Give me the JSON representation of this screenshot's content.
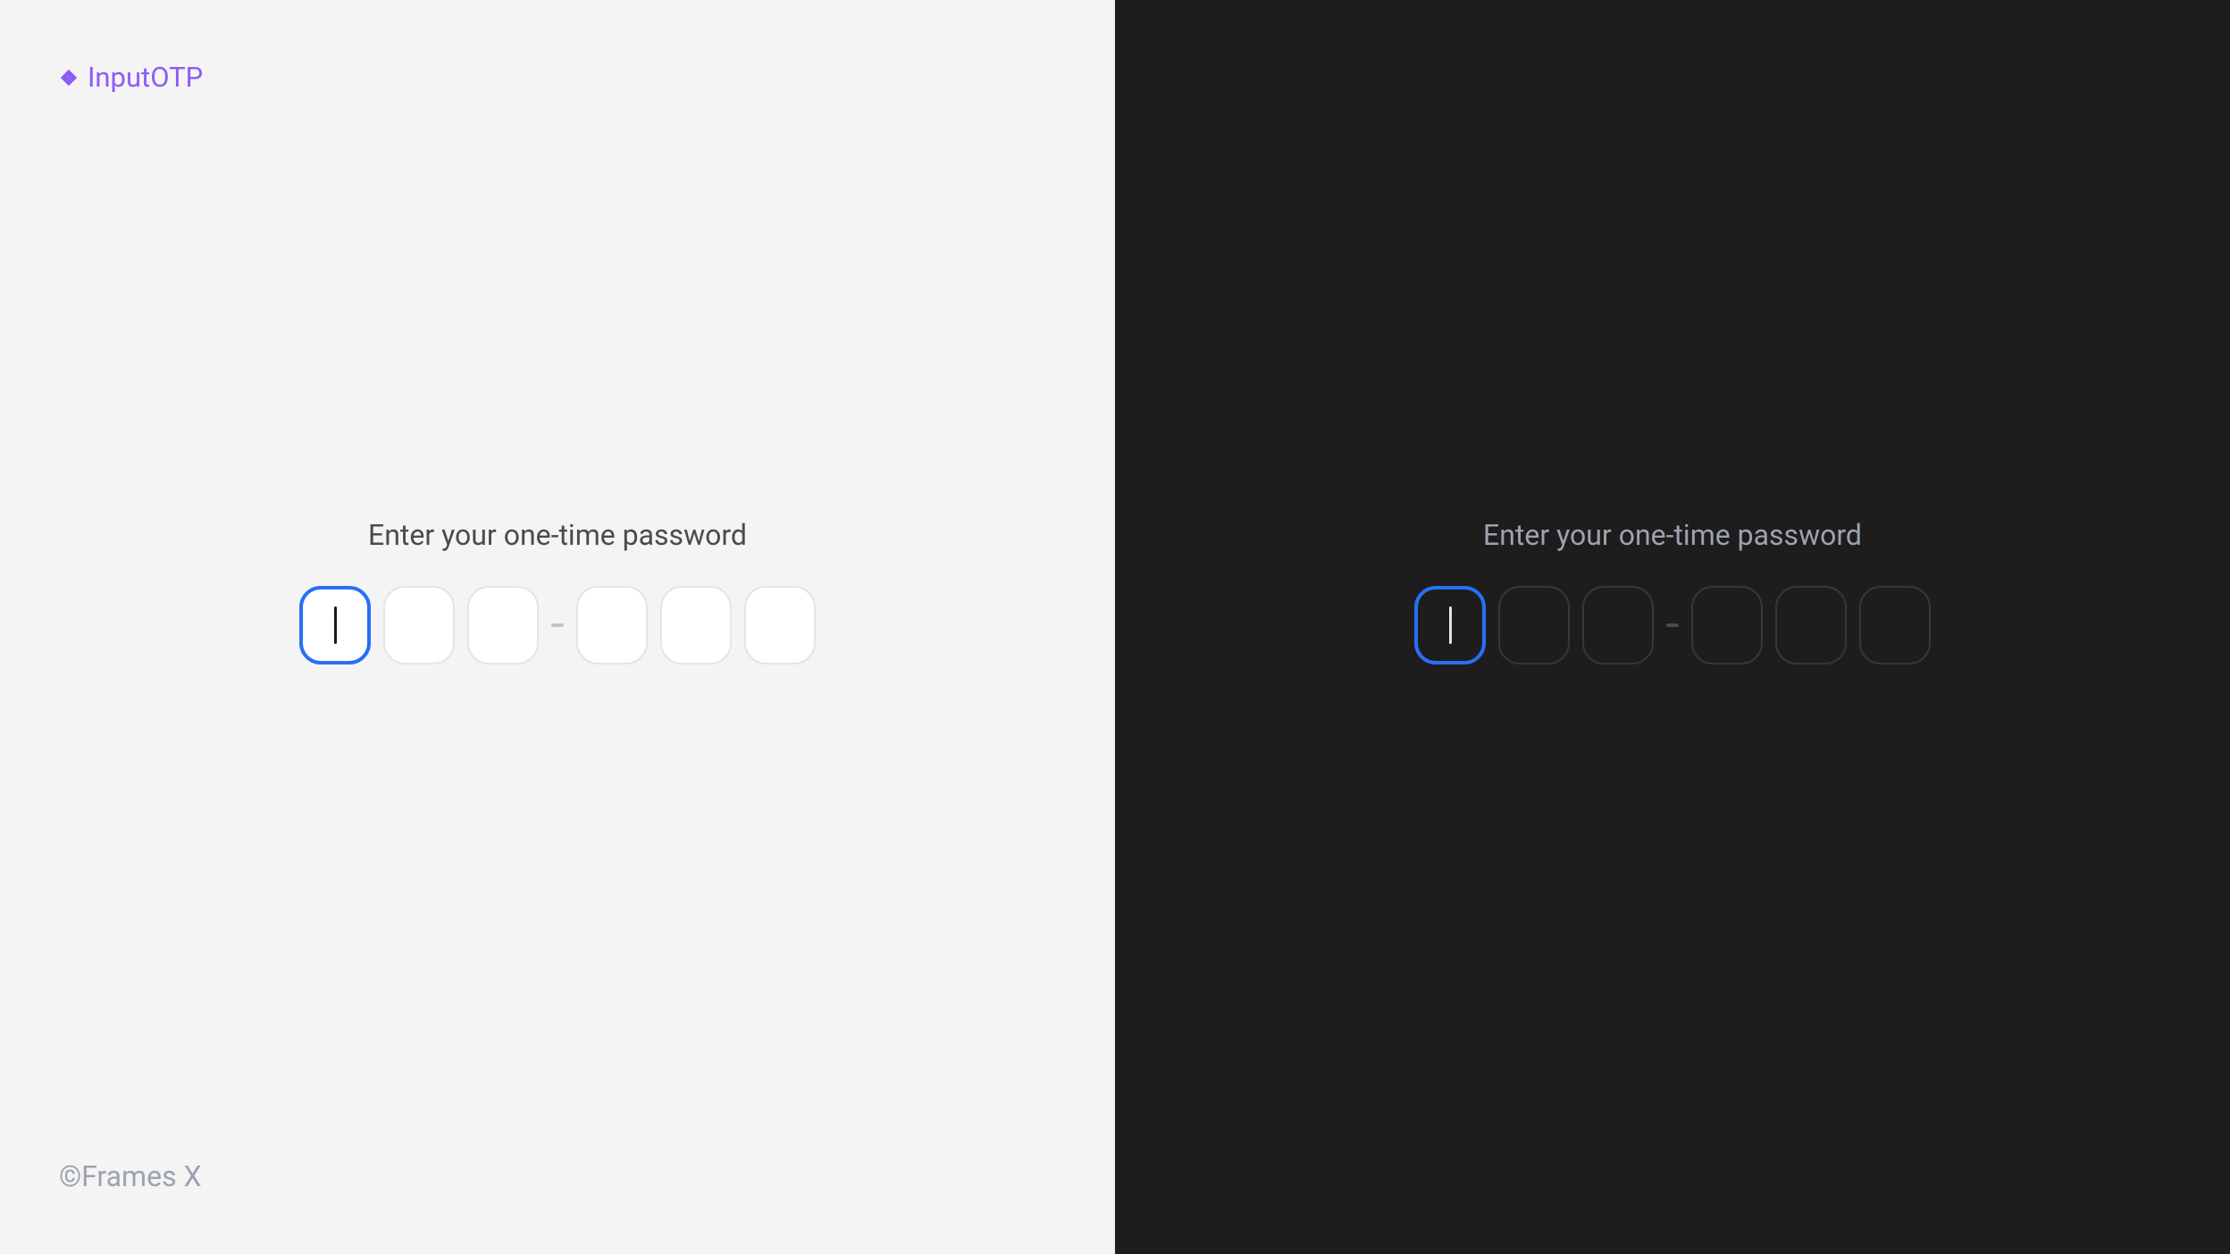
{
  "header": {
    "title": "InputOTP"
  },
  "footer": {
    "copyright": "©Frames X"
  },
  "otp": {
    "label": "Enter your one-time password"
  }
}
